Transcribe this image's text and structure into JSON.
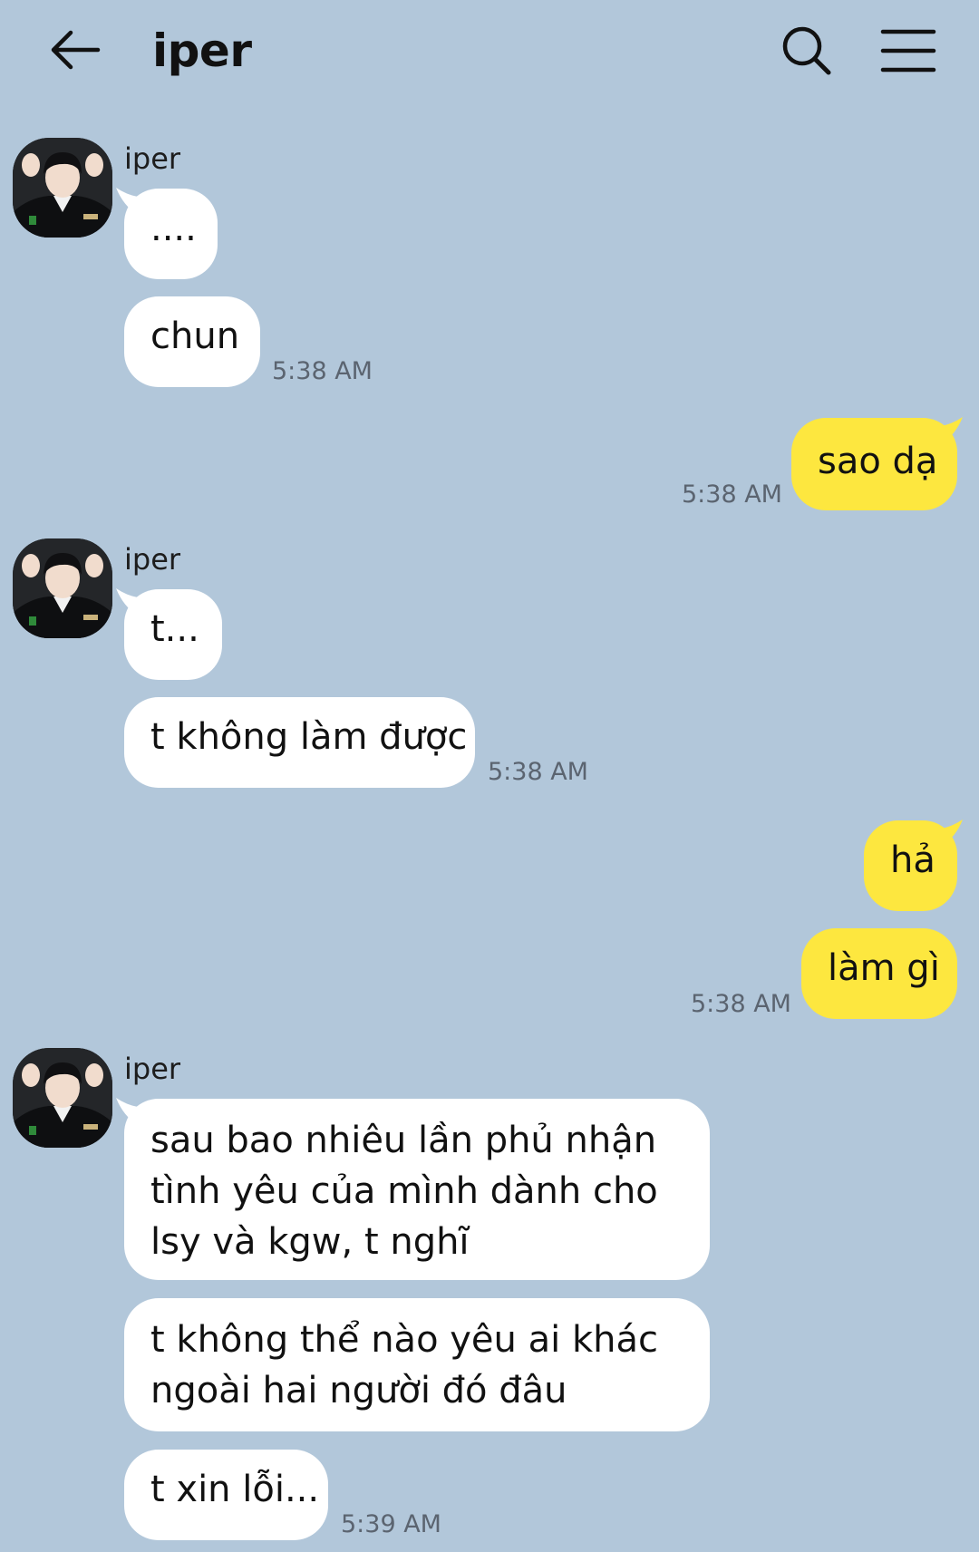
{
  "header": {
    "title": "iper",
    "back_icon": "arrow-left-icon",
    "search_icon": "search-icon",
    "menu_icon": "hamburger-menu-icon"
  },
  "colors": {
    "background": "#b2c7da",
    "incoming_bubble": "#ffffff",
    "outgoing_bubble": "#fde73f"
  },
  "messages": [
    {
      "direction": "in",
      "sender": "iper",
      "texts": [
        "....",
        "chun"
      ],
      "time": "5:38 AM"
    },
    {
      "direction": "out",
      "texts": [
        "sao dạ"
      ],
      "time": "5:38 AM"
    },
    {
      "direction": "in",
      "sender": "iper",
      "texts": [
        "t...",
        "t không làm được"
      ],
      "time": "5:38 AM"
    },
    {
      "direction": "out",
      "texts": [
        "hả",
        "làm gì"
      ],
      "time": "5:38 AM"
    },
    {
      "direction": "in",
      "sender": "iper",
      "texts": [
        "sau bao nhiêu lần phủ nhận tình yêu của mình dành cho lsy và kgw, t nghĩ",
        "t không thể nào yêu ai khác ngoài hai người đó đâu",
        "t xin lỗi..."
      ],
      "time": "5:39 AM"
    }
  ]
}
